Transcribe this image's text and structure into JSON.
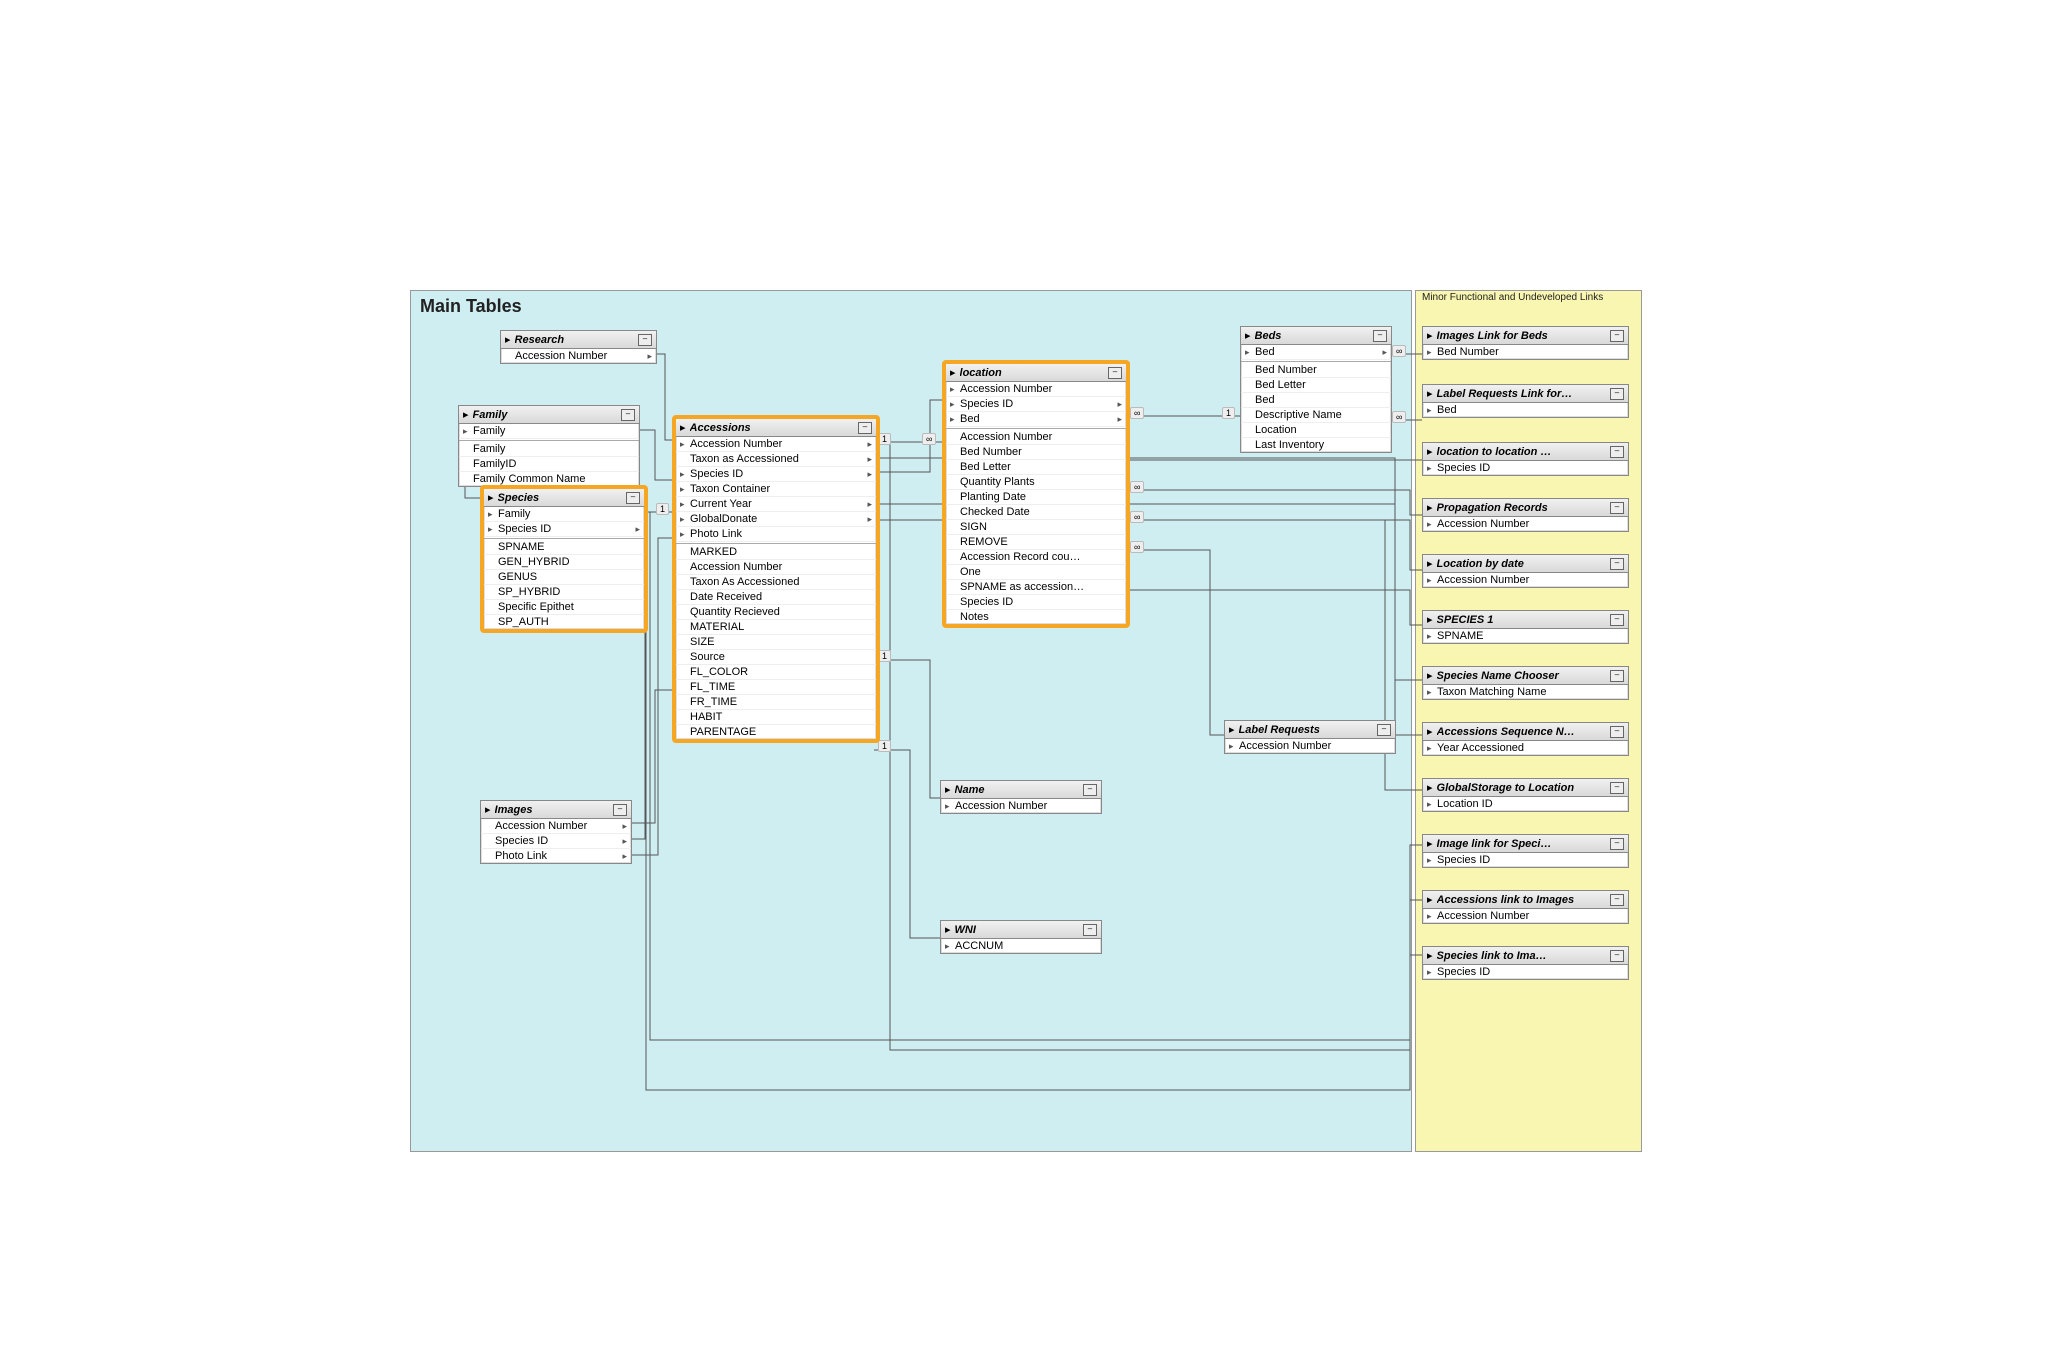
{
  "regions": {
    "main": {
      "title": "Main Tables"
    },
    "other": {
      "title": "Minor Functional and Undeveloped Links"
    }
  },
  "tables": {
    "research": {
      "title": "Research",
      "fields": [
        "Accession Number"
      ]
    },
    "family": {
      "title": "Family",
      "fields": [
        "Family"
      ],
      "extra": [
        "Family",
        "FamilyID",
        "Family Common Name"
      ]
    },
    "species": {
      "title": "Species",
      "fields": [
        "Family",
        "Species ID"
      ],
      "extra": [
        "SPNAME",
        "GEN_HYBRID",
        "GENUS",
        "SP_HYBRID",
        "Specific Epithet",
        "SP_AUTH"
      ]
    },
    "images": {
      "title": "Images",
      "fields": [
        "Accession Number",
        "Species ID",
        "Photo Link"
      ]
    },
    "accessions": {
      "title": "Accessions",
      "fields": [
        "Accession Number",
        "Taxon as Accessioned",
        "Species ID",
        "Taxon Container",
        "Current Year",
        "GlobalDonate",
        "Photo Link"
      ],
      "extra": [
        "MARKED",
        "Accession Number",
        "Taxon As Accessioned",
        "Date Received",
        "Quantity Recieved",
        "MATERIAL",
        "SIZE",
        "Source",
        "FL_COLOR",
        "FL_TIME",
        "FR_TIME",
        "HABIT",
        "PARENTAGE"
      ]
    },
    "location": {
      "title": "location",
      "fields": [
        "Accession Number",
        "Species ID",
        "Bed"
      ],
      "extra": [
        "Accession Number",
        "Bed Number",
        "Bed Letter",
        "Quantity Plants",
        "Planting Date",
        "Checked Date",
        "SIGN",
        "REMOVE",
        "Accession Record cou…",
        "One",
        "SPNAME as accession…",
        "Species ID",
        "Notes"
      ]
    },
    "name": {
      "title": "Name",
      "fields": [
        "Accession Number"
      ]
    },
    "wni": {
      "title": "WNI",
      "fields": [
        "ACCNUM"
      ]
    },
    "beds": {
      "title": "Beds",
      "fields": [
        "Bed"
      ],
      "extra": [
        "Bed Number",
        "Bed Letter",
        "Bed",
        "Descriptive Name",
        "Location",
        "Last Inventory"
      ]
    },
    "labelreq": {
      "title": "Label Requests",
      "fields": [
        "Accession Number"
      ]
    },
    "r_imgbeds": {
      "title": "Images Link for Beds",
      "fields": [
        "Bed Number"
      ]
    },
    "r_labelfor": {
      "title": "Label Requests Link for…",
      "fields": [
        "Bed"
      ]
    },
    "r_loc2loc": {
      "title": "location to location …",
      "fields": [
        "Species ID"
      ]
    },
    "r_prop": {
      "title": "Propagation Records",
      "fields": [
        "Accession Number"
      ]
    },
    "r_locdate": {
      "title": "Location by date",
      "fields": [
        "Accession Number"
      ]
    },
    "r_species1": {
      "title": "SPECIES 1",
      "fields": [
        "SPNAME"
      ]
    },
    "r_spnamech": {
      "title": "Species Name Chooser",
      "fields": [
        "Taxon Matching Name"
      ]
    },
    "r_accseq": {
      "title": "Accessions Sequence N…",
      "fields": [
        "Year Accessioned"
      ]
    },
    "r_globloc": {
      "title": "GlobalStorage to Location",
      "fields": [
        "Location ID"
      ]
    },
    "r_imgspec": {
      "title": "Image link for Speci…",
      "fields": [
        "Species ID"
      ]
    },
    "r_accimg": {
      "title": "Accessions link to Images",
      "fields": [
        "Accession Number"
      ]
    },
    "r_specimg": {
      "title": "Species link to Ima…",
      "fields": [
        "Species ID"
      ]
    }
  },
  "joins": {
    "one": "1",
    "many": "∞"
  }
}
